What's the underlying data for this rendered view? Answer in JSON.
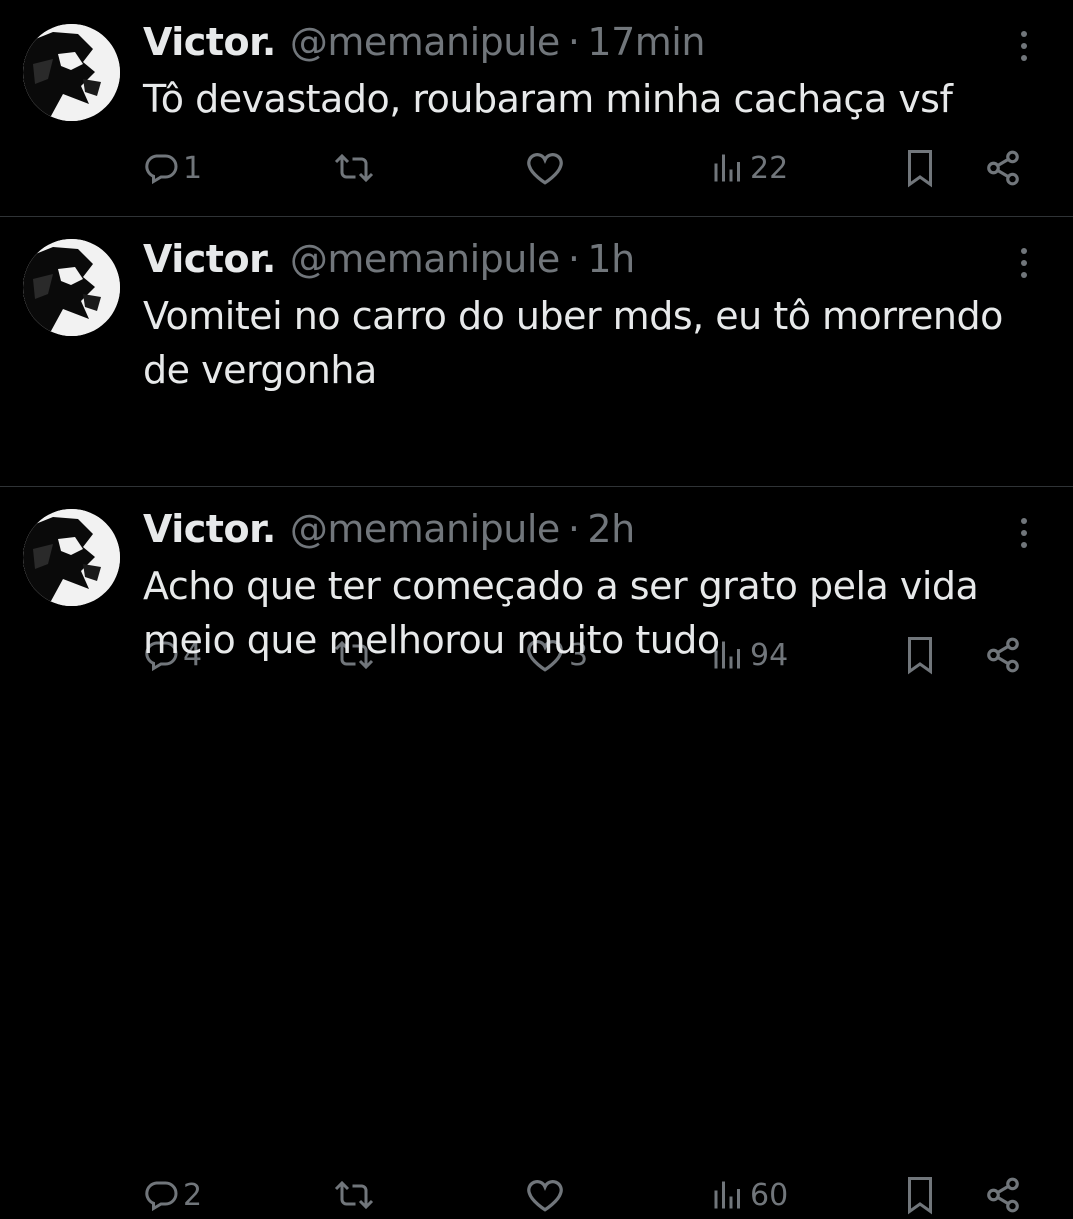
{
  "tweets": [
    {
      "author_name": "Victor.",
      "handle": "@memanipule",
      "separator": "·",
      "time": "17min",
      "text": "Tô devastado, roubaram minha cachaça vsf",
      "replies": "1",
      "retweets": "",
      "likes": "",
      "views": "22"
    },
    {
      "author_name": "Victor.",
      "handle": "@memanipule",
      "separator": "·",
      "time": "1h",
      "text": "Vomitei no carro do uber mds, eu tô morrendo de vergonha",
      "replies": "4",
      "retweets": "",
      "likes": "3",
      "views": "94"
    },
    {
      "author_name": "Victor.",
      "handle": "@memanipule",
      "separator": "·",
      "time": "2h",
      "text": "Acho que ter começado a ser grato pela vida meio que melhorou muito tudo",
      "replies": "2",
      "retweets": "",
      "likes": "",
      "views": "60"
    }
  ],
  "icons": {
    "reply": "reply-icon",
    "retweet": "retweet-icon",
    "like": "heart-icon",
    "views": "views-icon",
    "bookmark": "bookmark-icon",
    "share": "share-icon",
    "more": "more-icon"
  },
  "colors": {
    "background": "#000000",
    "text_primary": "#e7e9ea",
    "text_secondary": "#71767b",
    "divider": "#2f3336"
  }
}
